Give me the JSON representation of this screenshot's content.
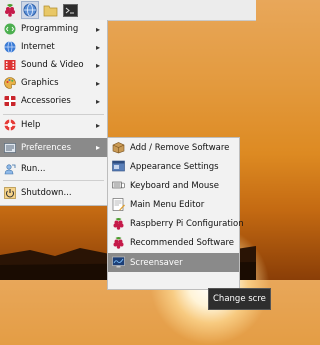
{
  "taskbar": {
    "buttons": [
      {
        "icon": "raspberry-icon"
      },
      {
        "icon": "globe-icon"
      },
      {
        "icon": "folder-icon"
      },
      {
        "icon": "terminal-icon"
      }
    ]
  },
  "menu": {
    "items": [
      {
        "label": "Programming",
        "icon": "programming-icon",
        "submenu": true
      },
      {
        "label": "Internet",
        "icon": "internet-icon",
        "submenu": true
      },
      {
        "label": "Sound & Video",
        "icon": "sound-video-icon",
        "submenu": true
      },
      {
        "label": "Graphics",
        "icon": "graphics-icon",
        "submenu": true
      },
      {
        "label": "Accessories",
        "icon": "accessories-icon",
        "submenu": true
      },
      {
        "label": "Help",
        "icon": "help-icon",
        "submenu": true
      },
      {
        "label": "Preferences",
        "icon": "preferences-icon",
        "submenu": true,
        "active": true
      },
      {
        "label": "Run...",
        "icon": "run-icon",
        "submenu": false
      },
      {
        "label": "Shutdown...",
        "icon": "shutdown-icon",
        "submenu": false
      }
    ]
  },
  "submenu": {
    "items": [
      {
        "label": "Add / Remove Software",
        "icon": "package-icon"
      },
      {
        "label": "Appearance Settings",
        "icon": "appearance-icon"
      },
      {
        "label": "Keyboard and Mouse",
        "icon": "keyboard-mouse-icon"
      },
      {
        "label": "Main Menu Editor",
        "icon": "menu-editor-icon"
      },
      {
        "label": "Raspberry Pi Configuration",
        "icon": "raspberry-icon"
      },
      {
        "label": "Recommended Software",
        "icon": "raspberry-icon"
      },
      {
        "label": "Screensaver",
        "icon": "screensaver-icon",
        "active": true
      }
    ]
  },
  "tooltip": {
    "text": "Change scre"
  },
  "colors": {
    "menu_bg": "#f2f2f2",
    "highlight": "#8a8a8a",
    "accent_raspberry": "#c51a4a"
  }
}
